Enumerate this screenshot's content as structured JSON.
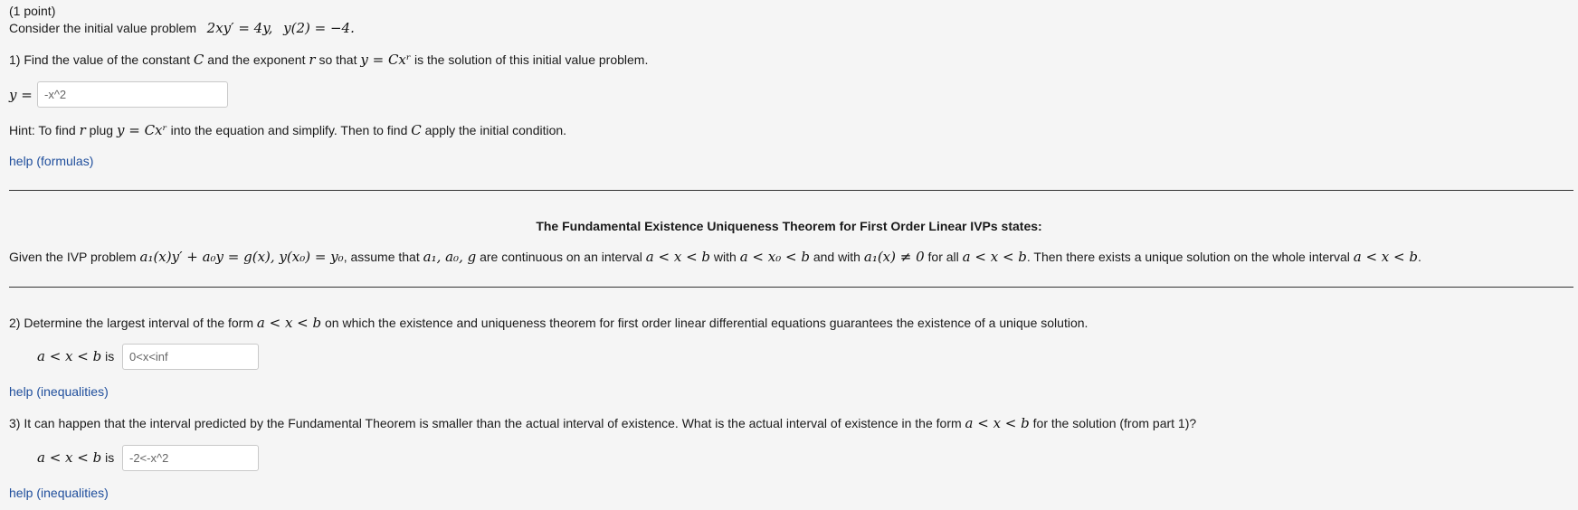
{
  "problem": {
    "points": "(1 point)",
    "intro": "Consider the initial value problem",
    "ode": "2xy′ = 4y,",
    "ic": "y(2) = −4."
  },
  "part1": {
    "text_a": "1) Find the value of the constant",
    "C": "C",
    "text_b": "and the exponent",
    "r": "r",
    "text_c": "so that",
    "expr": "y = Cxʳ",
    "text_d": "is the solution of this initial value problem.",
    "input_label": "y =",
    "input_value": "-x^2",
    "hint_a": "Hint: To find",
    "hint_r": "r",
    "hint_b": "plug",
    "hint_expr": "y = Cxʳ",
    "hint_c": "into the equation and simplify. Then to find",
    "hint_C": "C",
    "hint_d": "apply the initial condition.",
    "help": "help (formulas)"
  },
  "theorem": {
    "title": "The Fundamental Existence Uniqueness Theorem for First Order Linear IVPs states:",
    "t1": "Given the IVP problem",
    "m1": "a₁(x)y′ + a₀y = g(x),  y(x₀) = y₀",
    "t2": ", assume that",
    "m2": "a₁, a₀, g",
    "t3": "are continuous on an interval",
    "m3": "a < x < b",
    "t4": "with",
    "m4": "a < x₀ < b",
    "t5": "and with",
    "m5": "a₁(x) ≠ 0",
    "t6": "for all",
    "m6": "a < x < b",
    "t7": ". Then there exists a unique solution on the whole interval",
    "m7": "a < x < b",
    "t8": "."
  },
  "part2": {
    "text_a": "2) Determine the largest interval of the form",
    "expr": "a < x < b",
    "text_b": "on which the existence and uniqueness theorem for first order linear differential equations guarantees the existence of a unique solution.",
    "label_expr": "a < x < b",
    "label_is": "is",
    "input_value": "0<x<inf",
    "help": "help (inequalities)"
  },
  "part3": {
    "text_a": "3) It can happen that the interval predicted by the Fundamental Theorem is smaller than the actual interval of existence. What is the actual interval of existence in the form",
    "expr": "a < x < b",
    "text_b": "for the solution (from part 1)?",
    "label_expr": "a < x < b",
    "label_is": "is",
    "input_value": "-2<-x^2",
    "help": "help (inequalities)"
  }
}
